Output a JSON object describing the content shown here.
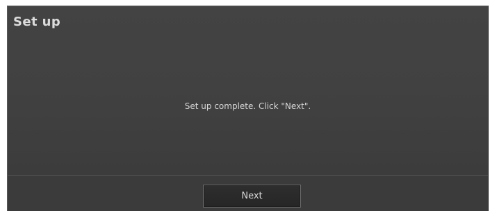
{
  "dialog": {
    "title": "Set up",
    "message": "Set up complete. Click \"Next\".",
    "next_label": "Next"
  }
}
